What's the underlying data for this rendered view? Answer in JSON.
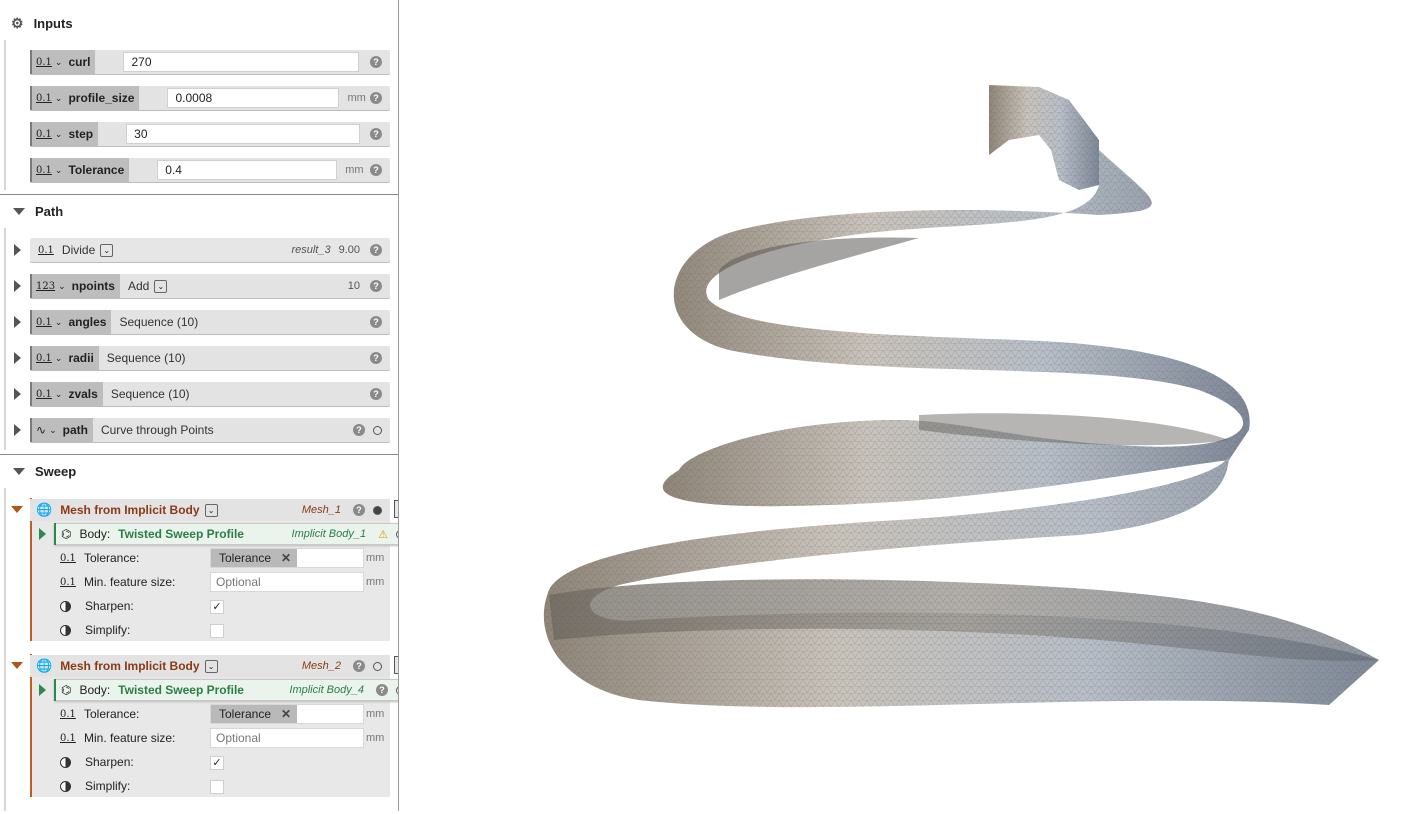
{
  "inputs": {
    "title": "Inputs",
    "rows": [
      {
        "num": "0.1",
        "name": "curl",
        "value": "270",
        "unit": ""
      },
      {
        "num": "0.1",
        "name": "profile_size",
        "value": "0.0008",
        "unit": "mm"
      },
      {
        "num": "0.1",
        "name": "step",
        "value": "30",
        "unit": ""
      },
      {
        "num": "0.1",
        "name": "Tolerance",
        "value": "0.4",
        "unit": "mm"
      }
    ]
  },
  "path": {
    "title": "Path",
    "divide": {
      "num": "0.1",
      "label": "Divide",
      "result": "result_3",
      "value": "9.00"
    },
    "npoints": {
      "num": "123",
      "name": "npoints",
      "op": "Add",
      "value": "10"
    },
    "angles": {
      "num": "0.1",
      "name": "angles",
      "op": "Sequence (10)"
    },
    "radii": {
      "num": "0.1",
      "name": "radii",
      "op": "Sequence (10)"
    },
    "zvals": {
      "num": "0.1",
      "name": "zvals",
      "op": "Sequence (10)"
    },
    "path": {
      "name": "path",
      "op": "Curve through Points"
    }
  },
  "sweep": {
    "title": "Sweep",
    "meshes": [
      {
        "title": "Mesh from Implicit Body",
        "result": "Mesh_1",
        "body_label": "Body:",
        "body_name": "Twisted Sweep Profile",
        "body_result": "Implicit Body_1",
        "tol_label": "Tolerance:",
        "tol_chip": "Tolerance",
        "tol_unit": "mm",
        "feat_label": "Min. feature size:",
        "feat_placeholder": "Optional",
        "feat_unit": "mm",
        "sharpen_label": "Sharpen:",
        "sharpen_mark": "✓",
        "simplify_label": "Simplify:"
      },
      {
        "title": "Mesh from Implicit Body",
        "result": "Mesh_2",
        "body_label": "Body:",
        "body_name": "Twisted Sweep Profile",
        "body_result": "Implicit Body_4",
        "tol_label": "Tolerance:",
        "tol_chip": "Tolerance",
        "tol_unit": "mm",
        "feat_label": "Min. feature size:",
        "feat_placeholder": "Optional",
        "feat_unit": "mm",
        "sharpen_label": "Sharpen:",
        "sharpen_mark": "✓",
        "simplify_label": "Simplify:"
      }
    ]
  },
  "icons": {
    "help": "?",
    "dropdown": "⌄",
    "pause": "||",
    "warning": "⚠"
  }
}
